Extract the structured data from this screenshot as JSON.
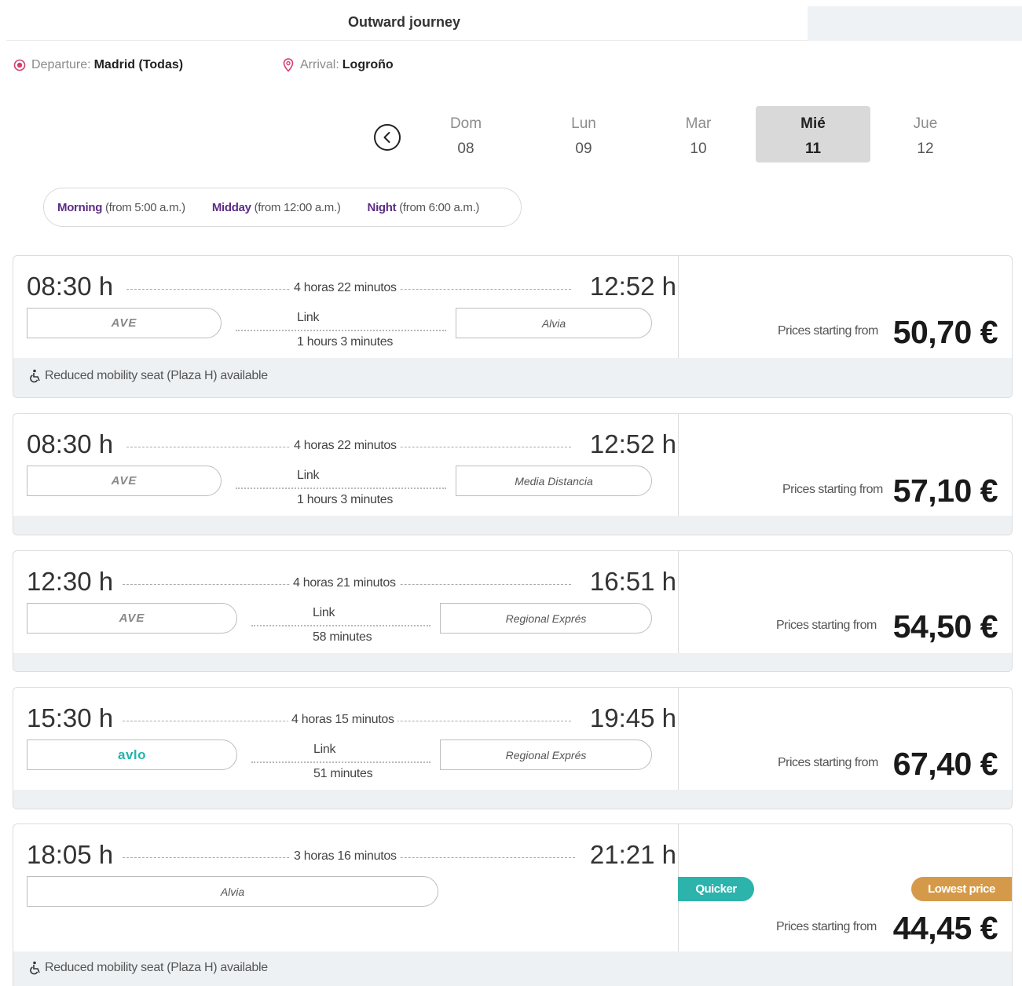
{
  "header": {
    "title": "Outward journey"
  },
  "route": {
    "departure_label": "Departure:",
    "departure_value": "Madrid (Todas)",
    "arrival_label": "Arrival:",
    "arrival_value": "Logroño"
  },
  "dates": [
    {
      "day": "Dom",
      "num": "08",
      "selected": false
    },
    {
      "day": "Lun",
      "num": "09",
      "selected": false
    },
    {
      "day": "Mar",
      "num": "10",
      "selected": false
    },
    {
      "day": "Mié",
      "num": "11",
      "selected": true
    },
    {
      "day": "Jue",
      "num": "12",
      "selected": false
    }
  ],
  "time_filter": [
    {
      "name": "Morning",
      "hint": "(from 5:00 a.m.)"
    },
    {
      "name": "Midday",
      "hint": "(from 12:00 a.m.)"
    },
    {
      "name": "Night",
      "hint": "(from 6:00 a.m.)"
    }
  ],
  "journeys": [
    {
      "departure": "08:30 h",
      "arrival": "12:52 h",
      "duration": "4 horas 22 minutos",
      "train1": "AVE",
      "link_label": "Link",
      "link_duration": "1 hours 3 minutes",
      "train2": "Alvia",
      "price_label": "Prices starting from",
      "price": "50,70 €",
      "footer_note": "Reduced mobility seat (Plaza H) available"
    },
    {
      "departure": "08:30 h",
      "arrival": "12:52 h",
      "duration": "4 horas 22 minutos",
      "train1": "AVE",
      "link_label": "Link",
      "link_duration": "1 hours 3 minutes",
      "train2": "Media Distancia",
      "price_label": "Prices starting from",
      "price": "57,10 €"
    },
    {
      "departure": "12:30 h",
      "arrival": "16:51 h",
      "duration": "4 horas 21 minutos",
      "train1": "AVE",
      "link_label": "Link",
      "link_duration": "58 minutes",
      "train2": "Regional Exprés",
      "price_label": "Prices starting from",
      "price": "54,50 €"
    },
    {
      "departure": "15:30 h",
      "arrival": "19:45 h",
      "duration": "4 horas 15 minutos",
      "train1": "avlo",
      "link_label": "Link",
      "link_duration": "51 minutes",
      "train2": "Regional Exprés",
      "price_label": "Prices starting from",
      "price": "67,40 €"
    },
    {
      "departure": "18:05 h",
      "arrival": "21:21 h",
      "duration": "3 horas 16 minutos",
      "train1": "Alvia",
      "badge_quicker": "Quicker",
      "badge_lowest": "Lowest price",
      "price_label": "Prices starting from",
      "price": "44,45 €",
      "footer_note": "Reduced mobility seat (Plaza H) available"
    }
  ],
  "colors": {
    "accent_purple": "#5b2d86",
    "departure_icon": "#d63d6b",
    "quicker_badge": "#2bb3ac",
    "lowest_badge": "#d59a49",
    "avlo_brand": "#22b5ac"
  },
  "icons": {
    "departure": "radio-dot-icon",
    "arrival": "location-pin-icon",
    "prev": "chevron-left-icon",
    "accessibility": "wheelchair-icon"
  }
}
